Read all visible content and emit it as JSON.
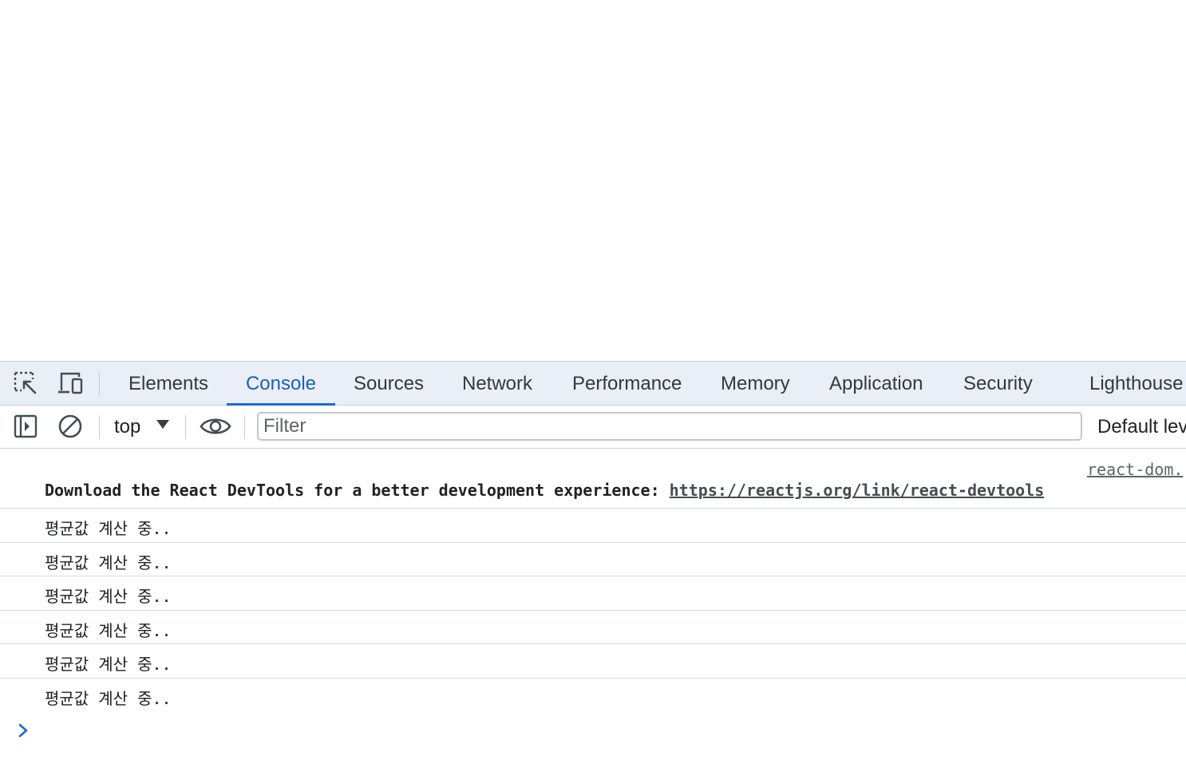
{
  "devtools": {
    "tabs": [
      {
        "label": "Elements"
      },
      {
        "label": "Console",
        "active": true
      },
      {
        "label": "Sources"
      },
      {
        "label": "Network"
      },
      {
        "label": "Performance"
      },
      {
        "label": "Memory"
      },
      {
        "label": "Application"
      },
      {
        "label": "Security"
      },
      {
        "label": "Lighthouse"
      }
    ],
    "icons": {
      "inspect": "inspect-element-icon",
      "device": "device-toolbar-icon",
      "sidebar": "console-sidebar-icon",
      "clear": "clear-console-icon",
      "eye": "live-expression-eye-icon",
      "prompt": "console-prompt-chevron-icon"
    },
    "colors": {
      "accent": "#1a68d8",
      "tabbar_bg": "#eaeff7",
      "divider": "#d3dcea"
    }
  },
  "toolbar": {
    "context_label": "top",
    "filter_placeholder": "Filter",
    "filter_value": "",
    "levels_label": "Default lev"
  },
  "console": {
    "source_link": "react-dom.",
    "devtools_message": {
      "text": "Download the React DevTools for a better development experience: ",
      "link": "https://reactjs.org/link/react-devtools"
    },
    "logs": [
      "평균값 계산 중..",
      "평균값 계산 중..",
      "평균값 계산 중..",
      "평균값 계산 중..",
      "평균값 계산 중..",
      "평균값 계산 중.."
    ]
  }
}
